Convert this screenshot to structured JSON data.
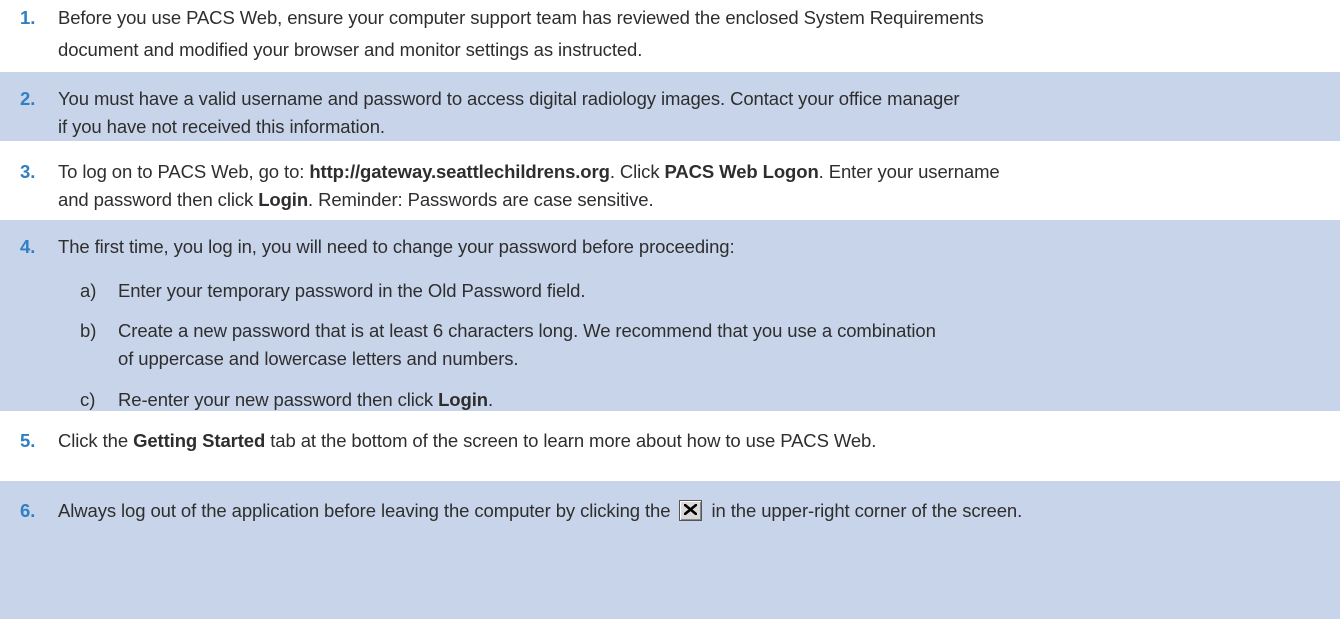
{
  "steps": [
    {
      "number": "1.",
      "lines": [
        {
          "parts": [
            {
              "t": "Before you use PACS Web, ensure your computer support team has reviewed the enclosed System Requirements"
            }
          ]
        },
        {
          "parts": [
            {
              "t": "document and modified your browser and monitor settings as instructed."
            }
          ]
        }
      ]
    },
    {
      "number": "2.",
      "lines": [
        {
          "parts": [
            {
              "t": "You must have a valid username and password to access digital radiology images. Contact your office manager"
            }
          ]
        },
        {
          "parts": [
            {
              "t": "if you have not received this information."
            }
          ]
        }
      ]
    },
    {
      "number": "3.",
      "lines": [
        {
          "parts": [
            {
              "t": "To log on to PACS Web, go to: "
            },
            {
              "t": "http://gateway.seattlechildrens.org",
              "b": true
            },
            {
              "t": ". Click "
            },
            {
              "t": "PACS Web Logon",
              "b": true
            },
            {
              "t": ". Enter your username"
            }
          ]
        },
        {
          "parts": [
            {
              "t": "and password then click "
            },
            {
              "t": "Login",
              "b": true
            },
            {
              "t": ". Reminder: Passwords are case sensitive."
            }
          ]
        }
      ]
    },
    {
      "number": "4.",
      "lines": [
        {
          "parts": [
            {
              "t": "The first time, you log in, you will need to change your password before proceeding:"
            }
          ]
        }
      ],
      "subitems": [
        {
          "marker": "a)",
          "lines": [
            {
              "parts": [
                {
                  "t": "Enter your temporary password in the Old Password field."
                }
              ]
            }
          ]
        },
        {
          "marker": "b)",
          "lines": [
            {
              "parts": [
                {
                  "t": "Create a new password that is at least 6 characters long. We recommend that you use a combination"
                }
              ]
            },
            {
              "parts": [
                {
                  "t": "of uppercase and lowercase letters and numbers."
                }
              ]
            }
          ]
        },
        {
          "marker": "c)",
          "lines": [
            {
              "parts": [
                {
                  "t": "Re-enter your new password then click "
                },
                {
                  "t": "Login",
                  "b": true
                },
                {
                  "t": "."
                }
              ]
            }
          ]
        }
      ]
    },
    {
      "number": "5.",
      "lines": [
        {
          "parts": [
            {
              "t": "Click the "
            },
            {
              "t": "Getting Started",
              "b": true
            },
            {
              "t": " tab at the bottom of the screen to learn more about how to use PACS Web."
            }
          ]
        }
      ]
    },
    {
      "number": "6.",
      "lines": [
        {
          "parts": [
            {
              "t": "Always log out of the application before leaving the computer by clicking the "
            },
            {
              "icon": "close-icon"
            },
            {
              "t": " in the upper-right corner of the screen."
            }
          ]
        }
      ]
    }
  ],
  "colors": {
    "shaded_band": "#c8d4ea",
    "number_blue": "#2f7fc4",
    "text": "#2e2e2e"
  }
}
